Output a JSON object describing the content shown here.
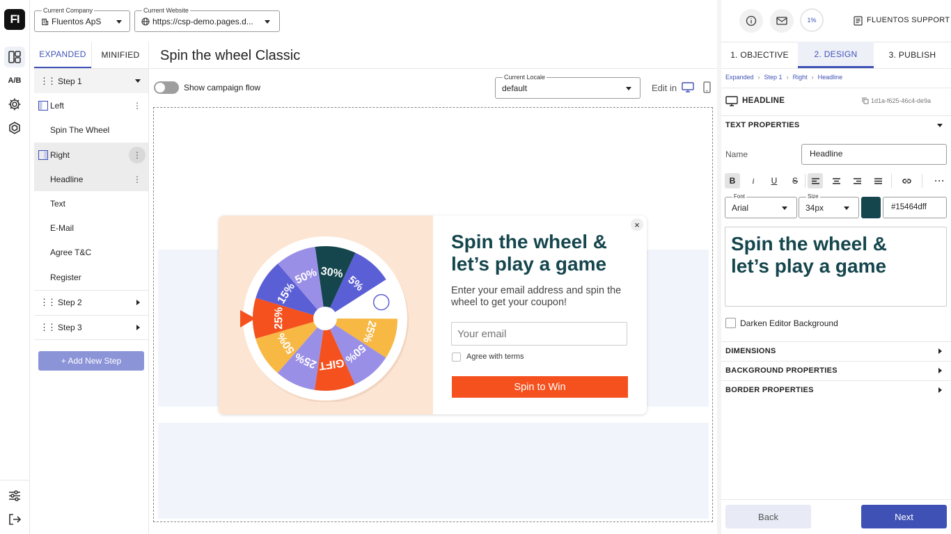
{
  "app": {
    "logo_text": "FI"
  },
  "rail": {
    "items": [
      {
        "name": "layout-icon"
      },
      {
        "name": "ab-test",
        "label": "A/B"
      },
      {
        "name": "gear-icon"
      },
      {
        "name": "components-icon"
      }
    ],
    "bottom": [
      {
        "name": "sliders-icon"
      },
      {
        "name": "logout-icon"
      }
    ]
  },
  "topbar": {
    "company_label": "Current Company",
    "company_value": "Fluentos ApS",
    "website_label": "Current Website",
    "website_value": "https://csp-demo.pages.d...",
    "progress": "1%",
    "support_label": "FLUENTOS SUPPORT"
  },
  "steps_panel": {
    "tabs": [
      "EXPANDED",
      "MINIFIED"
    ],
    "active_tab": "EXPANDED",
    "step1": "Step 1",
    "items": [
      {
        "label": "Left",
        "type": "column"
      },
      {
        "label": "Spin The Wheel",
        "type": "child"
      },
      {
        "label": "Right",
        "type": "column"
      },
      {
        "label": "Headline",
        "type": "child",
        "selected": true
      },
      {
        "label": "Text",
        "type": "child"
      },
      {
        "label": "E-Mail",
        "type": "child"
      },
      {
        "label": "Agree T&C",
        "type": "child"
      },
      {
        "label": "Register",
        "type": "child"
      }
    ],
    "step2": "Step 2",
    "step3": "Step 3",
    "add_step": "+ Add New Step"
  },
  "editor": {
    "title": "Spin the wheel Classic",
    "flow_toggle_label": "Show campaign flow",
    "locale_label": "Current Locale",
    "locale_value": "default",
    "edit_in": "Edit in"
  },
  "popup": {
    "headline": "Spin the wheel & let’s play a game",
    "subtext": "Enter your email address and spin the wheel to get your coupon!",
    "email_placeholder": "Your email",
    "terms_label": "Agree with terms",
    "cta": "Spin to Win",
    "close": "×",
    "wheel_segments": [
      "30%",
      "5%",
      "",
      "25%",
      "50%",
      "GIFT",
      "25%",
      "50%",
      "25%",
      "15%",
      "50%"
    ]
  },
  "right_panel": {
    "tabs": [
      "1. OBJECTIVE",
      "2. DESIGN",
      "3. PUBLISH"
    ],
    "active_tab": "2. DESIGN",
    "breadcrumb": [
      "Expanded",
      "Step 1",
      "Right",
      "Headline"
    ],
    "element_title": "HEADLINE",
    "element_id": "1d1a-f625-46c4-de9a",
    "text_properties": "TEXT PROPERTIES",
    "name_label": "Name",
    "name_value": "Headline",
    "font_label": "Font",
    "font_value": "Arial",
    "size_label": "Size",
    "size_value": "34px",
    "color_value": "#15464dff",
    "preview_text": "Spin the wheel & let’s play a game",
    "darken_label": "Darken Editor Background",
    "dimensions": "DIMENSIONS",
    "background_properties": "BACKGROUND PROPERTIES",
    "border_properties": "BORDER PROPERTIES",
    "back": "Back",
    "next": "Next"
  },
  "colors": {
    "accent": "#3f51b5",
    "headline": "#15464d",
    "cta": "#f4511e",
    "add_step": "#8c94d8",
    "popup_left_bg": "#fde5d3"
  }
}
